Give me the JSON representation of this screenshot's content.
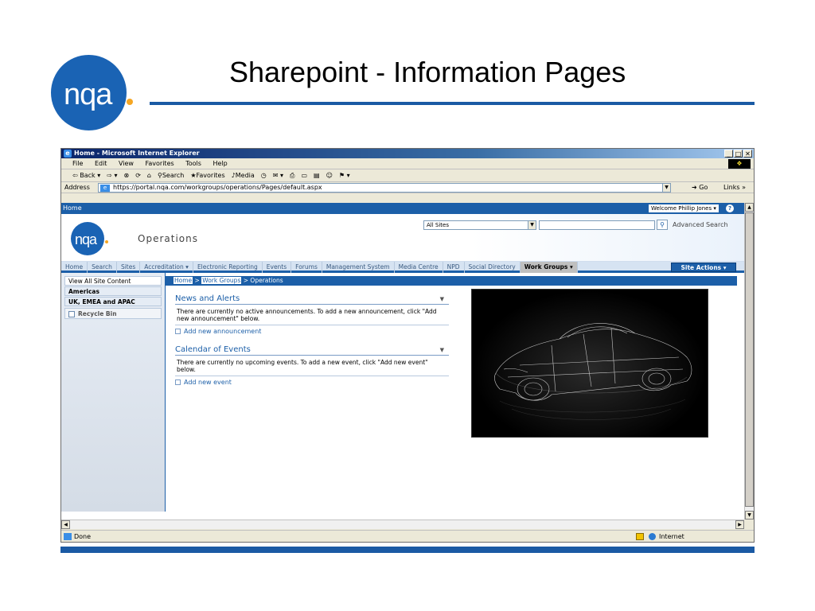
{
  "slide": {
    "title": "Sharepoint - Information Pages",
    "logo_text": "nqa"
  },
  "browser": {
    "window_title": "Home - Microsoft Internet Explorer",
    "menu": [
      "File",
      "Edit",
      "View",
      "Favorites",
      "Tools",
      "Help"
    ],
    "toolbar": {
      "back": "Back",
      "search": "Search",
      "favorites": "Favorites",
      "media": "Media"
    },
    "address_label": "Address",
    "address_value": "https://portal.nqa.com/workgroups/operations/Pages/default.aspx",
    "go_label": "Go",
    "links_label": "Links",
    "status_text": "Done",
    "zone_text": "Internet"
  },
  "sharepoint": {
    "topbar_home": "Home",
    "welcome": "Welcome Phillip Jones ▾",
    "logo_text": "nqa",
    "site_title": "Operations",
    "search_scope": "All Sites",
    "advanced_search": "Advanced Search",
    "nav": [
      "Home",
      "Search",
      "Sites",
      "Accreditation ▾",
      "Electronic Reporting",
      "Events",
      "Forums",
      "Management System",
      "Media Centre",
      "NPD",
      "Social Directory"
    ],
    "nav_active": "Work Groups ▾",
    "site_actions": "Site Actions ▾",
    "quick_launch": {
      "view_all": "View All Site Content",
      "items": [
        "Americas",
        "UK, EMEA and APAC"
      ],
      "recycle_bin": "Recycle Bin"
    },
    "breadcrumb": {
      "home": "Home",
      "sep1": ">",
      "work_groups": "Work Groups",
      "sep2": "> Operations"
    },
    "news": {
      "title": "News and Alerts",
      "body": "There are currently no active announcements. To add a new announcement, click \"Add new announcement\" below.",
      "add": "Add new announcement"
    },
    "calendar": {
      "title": "Calendar of Events",
      "body": "There are currently no upcoming events. To add a new event, click \"Add new event\" below.",
      "add": "Add new event"
    }
  },
  "colors": {
    "brand_blue": "#1a63b4",
    "sp_blue": "#1c5fa8",
    "accent_orange": "#f5a623"
  }
}
